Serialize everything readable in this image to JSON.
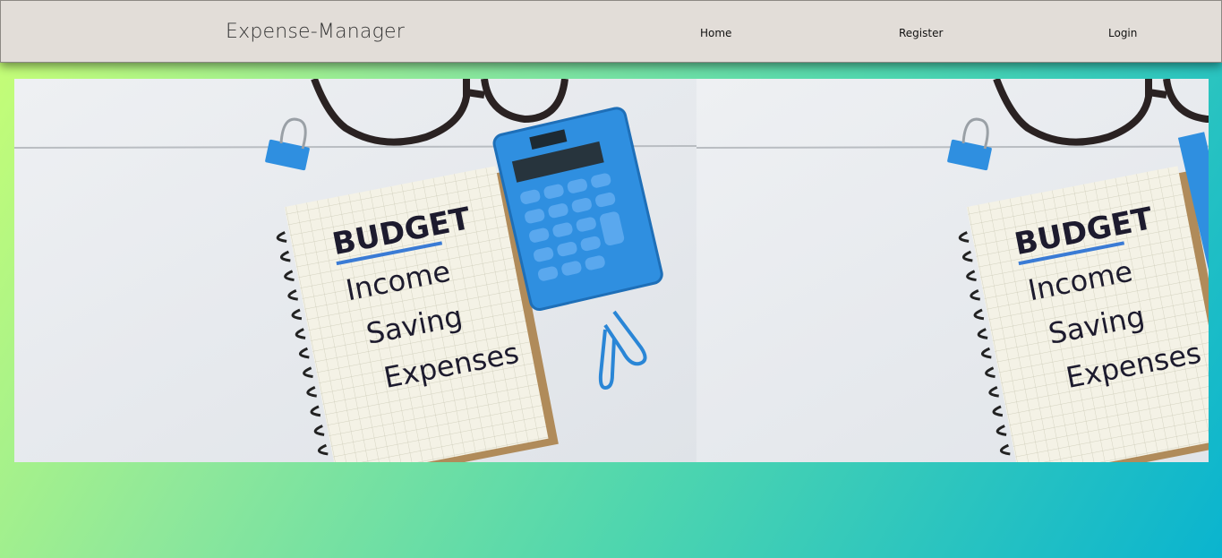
{
  "navbar": {
    "brand": "Expense-Manager",
    "links": [
      {
        "label": "Home"
      },
      {
        "label": "Register"
      },
      {
        "label": "Login"
      }
    ]
  },
  "banner": {
    "notebook_lines": [
      "BUDGET",
      "Income",
      "Saving",
      "Expenses"
    ]
  },
  "colors": {
    "navbar_bg": "#e2ddd8",
    "gradient_start": "#c8ff74",
    "gradient_end": "#0ab4cf",
    "calculator": "#2f8fe0"
  }
}
